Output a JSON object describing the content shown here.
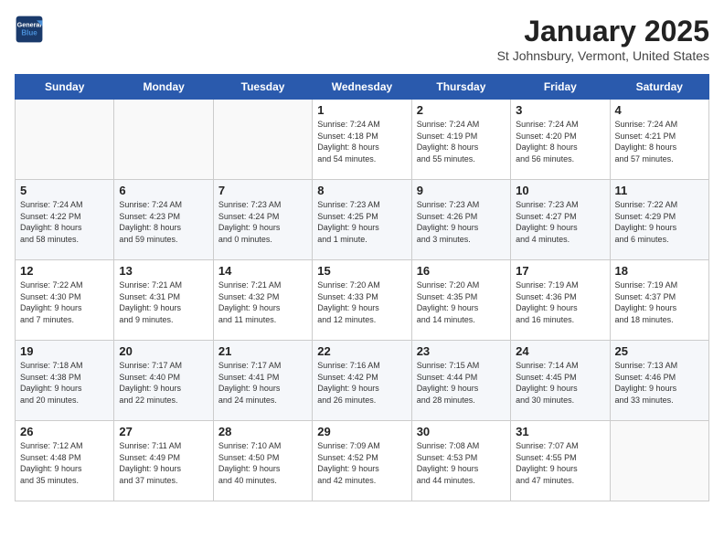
{
  "header": {
    "logo_line1": "General",
    "logo_line2": "Blue",
    "title": "January 2025",
    "subtitle": "St Johnsbury, Vermont, United States"
  },
  "weekdays": [
    "Sunday",
    "Monday",
    "Tuesday",
    "Wednesday",
    "Thursday",
    "Friday",
    "Saturday"
  ],
  "weeks": [
    [
      {
        "day": "",
        "info": ""
      },
      {
        "day": "",
        "info": ""
      },
      {
        "day": "",
        "info": ""
      },
      {
        "day": "1",
        "info": "Sunrise: 7:24 AM\nSunset: 4:18 PM\nDaylight: 8 hours\nand 54 minutes."
      },
      {
        "day": "2",
        "info": "Sunrise: 7:24 AM\nSunset: 4:19 PM\nDaylight: 8 hours\nand 55 minutes."
      },
      {
        "day": "3",
        "info": "Sunrise: 7:24 AM\nSunset: 4:20 PM\nDaylight: 8 hours\nand 56 minutes."
      },
      {
        "day": "4",
        "info": "Sunrise: 7:24 AM\nSunset: 4:21 PM\nDaylight: 8 hours\nand 57 minutes."
      }
    ],
    [
      {
        "day": "5",
        "info": "Sunrise: 7:24 AM\nSunset: 4:22 PM\nDaylight: 8 hours\nand 58 minutes."
      },
      {
        "day": "6",
        "info": "Sunrise: 7:24 AM\nSunset: 4:23 PM\nDaylight: 8 hours\nand 59 minutes."
      },
      {
        "day": "7",
        "info": "Sunrise: 7:23 AM\nSunset: 4:24 PM\nDaylight: 9 hours\nand 0 minutes."
      },
      {
        "day": "8",
        "info": "Sunrise: 7:23 AM\nSunset: 4:25 PM\nDaylight: 9 hours\nand 1 minute."
      },
      {
        "day": "9",
        "info": "Sunrise: 7:23 AM\nSunset: 4:26 PM\nDaylight: 9 hours\nand 3 minutes."
      },
      {
        "day": "10",
        "info": "Sunrise: 7:23 AM\nSunset: 4:27 PM\nDaylight: 9 hours\nand 4 minutes."
      },
      {
        "day": "11",
        "info": "Sunrise: 7:22 AM\nSunset: 4:29 PM\nDaylight: 9 hours\nand 6 minutes."
      }
    ],
    [
      {
        "day": "12",
        "info": "Sunrise: 7:22 AM\nSunset: 4:30 PM\nDaylight: 9 hours\nand 7 minutes."
      },
      {
        "day": "13",
        "info": "Sunrise: 7:21 AM\nSunset: 4:31 PM\nDaylight: 9 hours\nand 9 minutes."
      },
      {
        "day": "14",
        "info": "Sunrise: 7:21 AM\nSunset: 4:32 PM\nDaylight: 9 hours\nand 11 minutes."
      },
      {
        "day": "15",
        "info": "Sunrise: 7:20 AM\nSunset: 4:33 PM\nDaylight: 9 hours\nand 12 minutes."
      },
      {
        "day": "16",
        "info": "Sunrise: 7:20 AM\nSunset: 4:35 PM\nDaylight: 9 hours\nand 14 minutes."
      },
      {
        "day": "17",
        "info": "Sunrise: 7:19 AM\nSunset: 4:36 PM\nDaylight: 9 hours\nand 16 minutes."
      },
      {
        "day": "18",
        "info": "Sunrise: 7:19 AM\nSunset: 4:37 PM\nDaylight: 9 hours\nand 18 minutes."
      }
    ],
    [
      {
        "day": "19",
        "info": "Sunrise: 7:18 AM\nSunset: 4:38 PM\nDaylight: 9 hours\nand 20 minutes."
      },
      {
        "day": "20",
        "info": "Sunrise: 7:17 AM\nSunset: 4:40 PM\nDaylight: 9 hours\nand 22 minutes."
      },
      {
        "day": "21",
        "info": "Sunrise: 7:17 AM\nSunset: 4:41 PM\nDaylight: 9 hours\nand 24 minutes."
      },
      {
        "day": "22",
        "info": "Sunrise: 7:16 AM\nSunset: 4:42 PM\nDaylight: 9 hours\nand 26 minutes."
      },
      {
        "day": "23",
        "info": "Sunrise: 7:15 AM\nSunset: 4:44 PM\nDaylight: 9 hours\nand 28 minutes."
      },
      {
        "day": "24",
        "info": "Sunrise: 7:14 AM\nSunset: 4:45 PM\nDaylight: 9 hours\nand 30 minutes."
      },
      {
        "day": "25",
        "info": "Sunrise: 7:13 AM\nSunset: 4:46 PM\nDaylight: 9 hours\nand 33 minutes."
      }
    ],
    [
      {
        "day": "26",
        "info": "Sunrise: 7:12 AM\nSunset: 4:48 PM\nDaylight: 9 hours\nand 35 minutes."
      },
      {
        "day": "27",
        "info": "Sunrise: 7:11 AM\nSunset: 4:49 PM\nDaylight: 9 hours\nand 37 minutes."
      },
      {
        "day": "28",
        "info": "Sunrise: 7:10 AM\nSunset: 4:50 PM\nDaylight: 9 hours\nand 40 minutes."
      },
      {
        "day": "29",
        "info": "Sunrise: 7:09 AM\nSunset: 4:52 PM\nDaylight: 9 hours\nand 42 minutes."
      },
      {
        "day": "30",
        "info": "Sunrise: 7:08 AM\nSunset: 4:53 PM\nDaylight: 9 hours\nand 44 minutes."
      },
      {
        "day": "31",
        "info": "Sunrise: 7:07 AM\nSunset: 4:55 PM\nDaylight: 9 hours\nand 47 minutes."
      },
      {
        "day": "",
        "info": ""
      }
    ]
  ]
}
